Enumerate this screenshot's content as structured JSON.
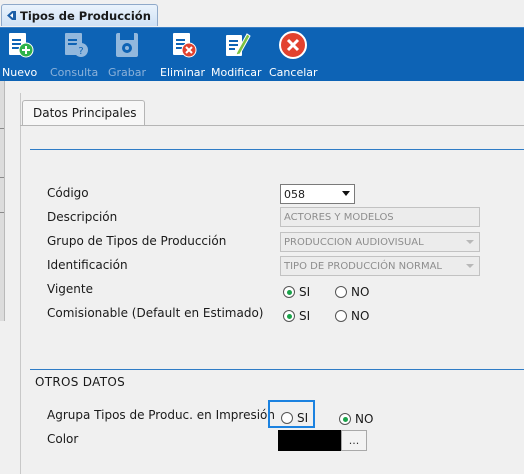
{
  "window": {
    "title": "Tipos de Producción"
  },
  "toolbar": {
    "buttons": [
      {
        "label": "Nuevo",
        "icon": "new-document-icon",
        "enabled": true
      },
      {
        "label": "Consulta",
        "icon": "query-document-icon",
        "enabled": false
      },
      {
        "label": "Grabar",
        "icon": "save-disk-icon",
        "enabled": false
      },
      {
        "label": "Eliminar",
        "icon": "delete-document-icon",
        "enabled": true
      },
      {
        "label": "Modificar",
        "icon": "edit-document-icon",
        "enabled": true
      },
      {
        "label": "Cancelar",
        "icon": "cancel-icon",
        "enabled": true
      }
    ]
  },
  "tab": {
    "label": "Datos Principales"
  },
  "form": {
    "codigo": {
      "label": "Código",
      "value": "058"
    },
    "descripcion": {
      "label": "Descripción",
      "value": "ACTORES Y MODELOS"
    },
    "grupo": {
      "label": "Grupo de Tipos de Producción",
      "value": "PRODUCCION AUDIOVISUAL"
    },
    "identificacion": {
      "label": "Identificación",
      "value": "TIPO DE PRODUCCIÓN NORMAL"
    },
    "vigente": {
      "label": "Vigente",
      "si": "SI",
      "no": "NO",
      "selected": "SI"
    },
    "comisionable": {
      "label": "Comisionable (Default en Estimado)",
      "si": "SI",
      "no": "NO",
      "selected": "SI"
    }
  },
  "otros": {
    "title": "OTROS DATOS",
    "agrupa": {
      "label": "Agrupa Tipos de Produc. en Impresión",
      "si": "SI",
      "no": "NO",
      "selected": "NO"
    },
    "color": {
      "label": "Color",
      "value": "#000000",
      "button": "..."
    }
  },
  "colors": {
    "toolbar": "#0d63b5",
    "accent": "#2f7cc6",
    "radio_on": "#1aa34a"
  }
}
